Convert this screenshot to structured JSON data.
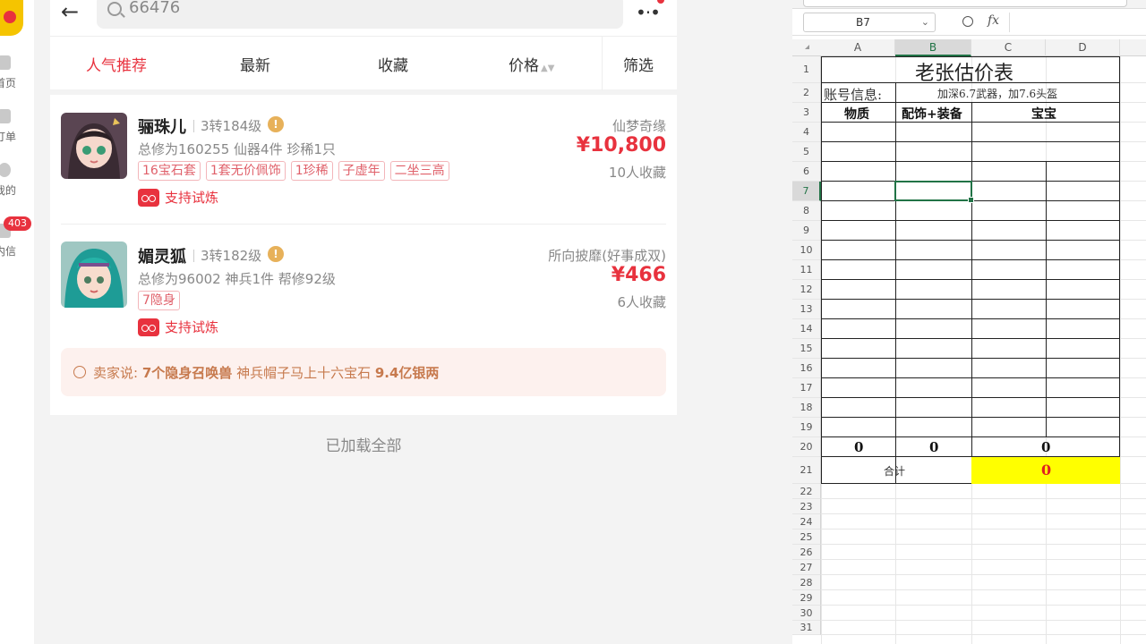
{
  "nav": {
    "items": [
      {
        "label": "首页",
        "icon": "home-icon"
      },
      {
        "label": "订单",
        "icon": "order-icon"
      },
      {
        "label": "我的",
        "icon": "user-icon"
      },
      {
        "label": "内信",
        "icon": "message-icon"
      }
    ],
    "badge": "403"
  },
  "search": {
    "value": "66476"
  },
  "sort_tabs": [
    {
      "label": "人气推荐",
      "active": true
    },
    {
      "label": "最新",
      "active": false
    },
    {
      "label": "收藏",
      "active": false
    },
    {
      "label": "价格",
      "active": false,
      "arrows": "▲▼"
    }
  ],
  "filter_label": "筛选",
  "listings": [
    {
      "name": "骊珠儿",
      "level": "3转184级",
      "stats": "总修为160255  仙器4件  珍稀1只",
      "tags": [
        "16宝石套",
        "1套无价佩饰",
        "1珍稀",
        "子虚年",
        "二坐三高"
      ],
      "trial": "支持试炼",
      "server": "仙梦奇缘",
      "price": "¥10,800",
      "favs": "10人收藏"
    },
    {
      "name": "媚灵狐",
      "level": "3转182级",
      "stats": "总修为96002  神兵1件  帮修92级",
      "tags": [
        "7隐身"
      ],
      "trial": "支持试炼",
      "server": "所向披靡(好事成双)",
      "price": "¥466",
      "favs": "6人收藏"
    }
  ],
  "seller": {
    "prefix": "卖家说:",
    "bold1": "7个隐身召唤兽",
    "mid": " 神兵帽子马上十六宝石 ",
    "bold2": "9.4亿银两"
  },
  "loaded_text": "已加载全部",
  "sheet": {
    "name_box": "B7",
    "fx": "fx",
    "columns": [
      "A",
      "B",
      "C",
      "D"
    ],
    "rows": [
      "1",
      "2",
      "3",
      "4",
      "5",
      "6",
      "7",
      "8",
      "9",
      "10",
      "11",
      "12",
      "13",
      "14",
      "15",
      "16",
      "17",
      "18",
      "19",
      "20",
      "21",
      "22",
      "23",
      "24",
      "25",
      "26",
      "27",
      "28",
      "29",
      "30",
      "31"
    ],
    "title": "老张估价表",
    "account_label": "账号信息:",
    "account_value": "加深6.7武器，加7.6头盔",
    "headers": [
      "物质",
      "配饰+装备",
      "宝宝"
    ],
    "totals": [
      "0",
      "0",
      "0"
    ],
    "sum_label": "合计",
    "sum_value": "0",
    "colors": {
      "accent": "#217346",
      "highlight": "#ffff00",
      "sum_text": "#e02020"
    }
  }
}
